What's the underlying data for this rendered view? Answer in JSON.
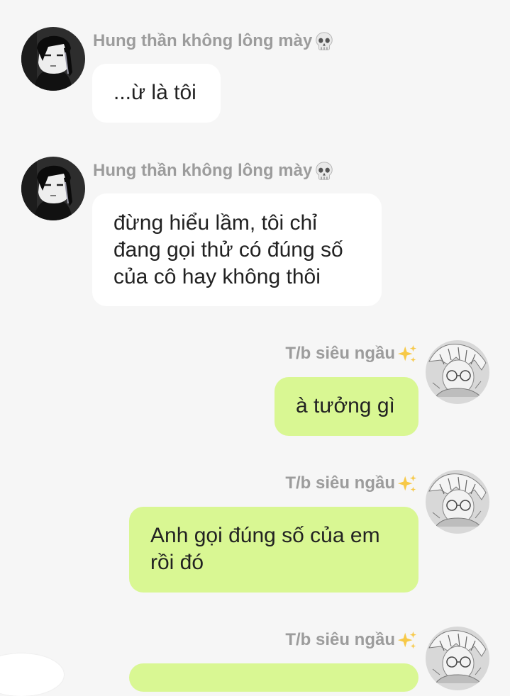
{
  "contacts": {
    "other": {
      "name": "Hung thần không lông mày",
      "emoji": "skull-icon"
    },
    "self": {
      "name": "T/b siêu ngầu",
      "emoji": "sparkles-icon"
    }
  },
  "messages": [
    {
      "side": "in",
      "sender": "Hung thần không lông mày",
      "text": "...ừ là tôi"
    },
    {
      "side": "in",
      "sender": "Hung thần không lông mày",
      "text": "đừng hiểu lầm, tôi chỉ đang gọi thử có đúng số của cô hay không thôi"
    },
    {
      "side": "out",
      "sender": "T/b siêu ngầu",
      "text": "à tưởng gì"
    },
    {
      "side": "out",
      "sender": "T/b siêu ngầu",
      "text": "Anh gọi đúng số của em rồi đó"
    },
    {
      "side": "out",
      "sender": "T/b siêu ngầu",
      "text": ""
    }
  ],
  "colors": {
    "background": "#f6f6f6",
    "incoming_bubble": "#ffffff",
    "outgoing_bubble": "#d9f793",
    "sender_name": "#9c9c9c",
    "message_text": "#222222"
  }
}
